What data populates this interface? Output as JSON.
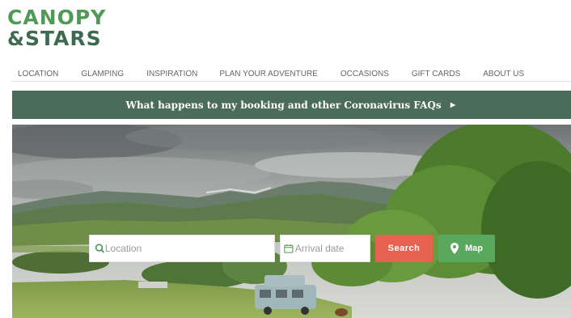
{
  "brand": {
    "line1": "CANOPY",
    "amp": "&",
    "line2": "STARS"
  },
  "nav": {
    "items": [
      {
        "label": "LOCATION"
      },
      {
        "label": "GLAMPING"
      },
      {
        "label": "INSPIRATION"
      },
      {
        "label": "PLAN YOUR ADVENTURE"
      },
      {
        "label": "OCCASIONS"
      },
      {
        "label": "GIFT CARDS"
      },
      {
        "label": "ABOUT US"
      }
    ]
  },
  "banner": {
    "text": "What happens to my booking and other Coronavirus FAQs",
    "arrow": "►"
  },
  "search": {
    "location_placeholder": "Location",
    "date_placeholder": "Arrival date",
    "search_label": "Search",
    "map_label": "Map"
  },
  "colors": {
    "brand_green": "#4e9a56",
    "brand_dark": "#3e6b50",
    "banner_bg": "#4b6c59",
    "search_btn": "#e8634f",
    "map_btn": "#5aa85e"
  },
  "icons": {
    "location_field": "search-icon",
    "date_field": "calendar-icon",
    "map_button": "map-pin-icon",
    "banner": "play-arrow-icon"
  }
}
